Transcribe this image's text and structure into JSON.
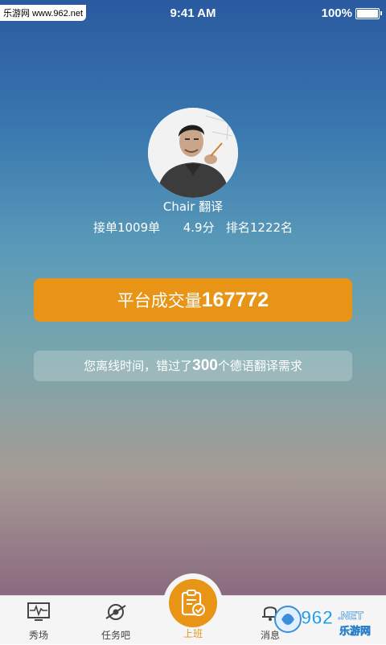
{
  "status_bar": {
    "watermark": "乐游网 www.962.net",
    "time": "9:41 AM",
    "battery": "100%"
  },
  "profile": {
    "name": "Chair 翻译",
    "stats": "接单1009单      4.9分   排名1222名"
  },
  "volume": {
    "label": "平台成交量",
    "value": "167772"
  },
  "missed": {
    "prefix": "您离线时间，错过了",
    "count": "300",
    "suffix": "个德语翻译需求"
  },
  "tabs": [
    {
      "label": "秀场",
      "icon": "pulse-monitor-icon"
    },
    {
      "label": "任务吧",
      "icon": "orbit-icon"
    },
    {
      "label": "上班",
      "icon": "clipboard-check-icon"
    },
    {
      "label": "消息",
      "icon": "bell-icon"
    }
  ],
  "watermark_br": {
    "num": "962",
    "suffix": ".NET",
    "site": "乐游网"
  },
  "colors": {
    "accent": "#e89417",
    "tabbar": "#f5f5f5"
  }
}
